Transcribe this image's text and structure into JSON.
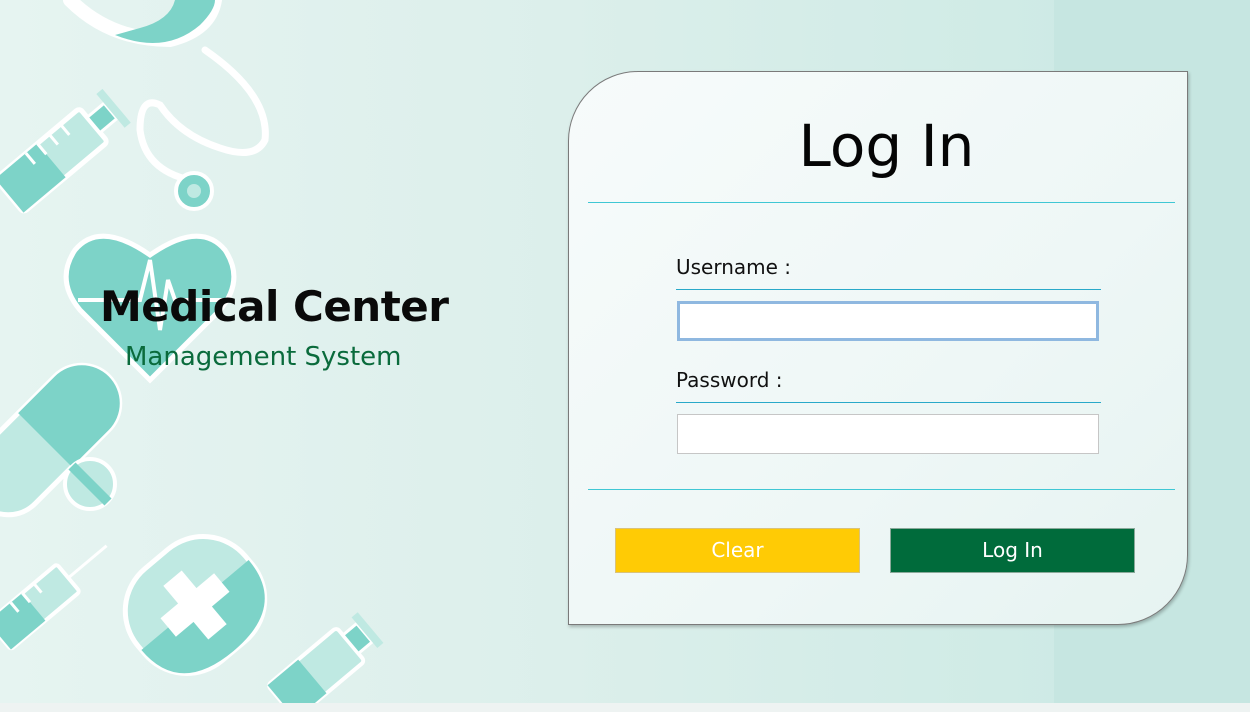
{
  "brand": {
    "title": "Medical Center",
    "subtitle": "Management System"
  },
  "login_card": {
    "title": "Log In",
    "username_label": "Username :",
    "username_value": "",
    "password_label": "Password :",
    "password_value": "",
    "clear_label": "Clear",
    "login_label": "Log In"
  },
  "colors": {
    "accent_teal": "#7dd3c8",
    "divider": "#3fc7d4",
    "clear_button": "#ffcb05",
    "login_button": "#006b3b",
    "subtitle_green": "#0a6b3c"
  },
  "decorations": [
    "stethoscope-icon",
    "syringe-icon",
    "heart-pulse-icon",
    "pill-capsule-icon",
    "pill-tablet-icon",
    "medical-bag-icon",
    "vaccine-syringe-icon"
  ]
}
